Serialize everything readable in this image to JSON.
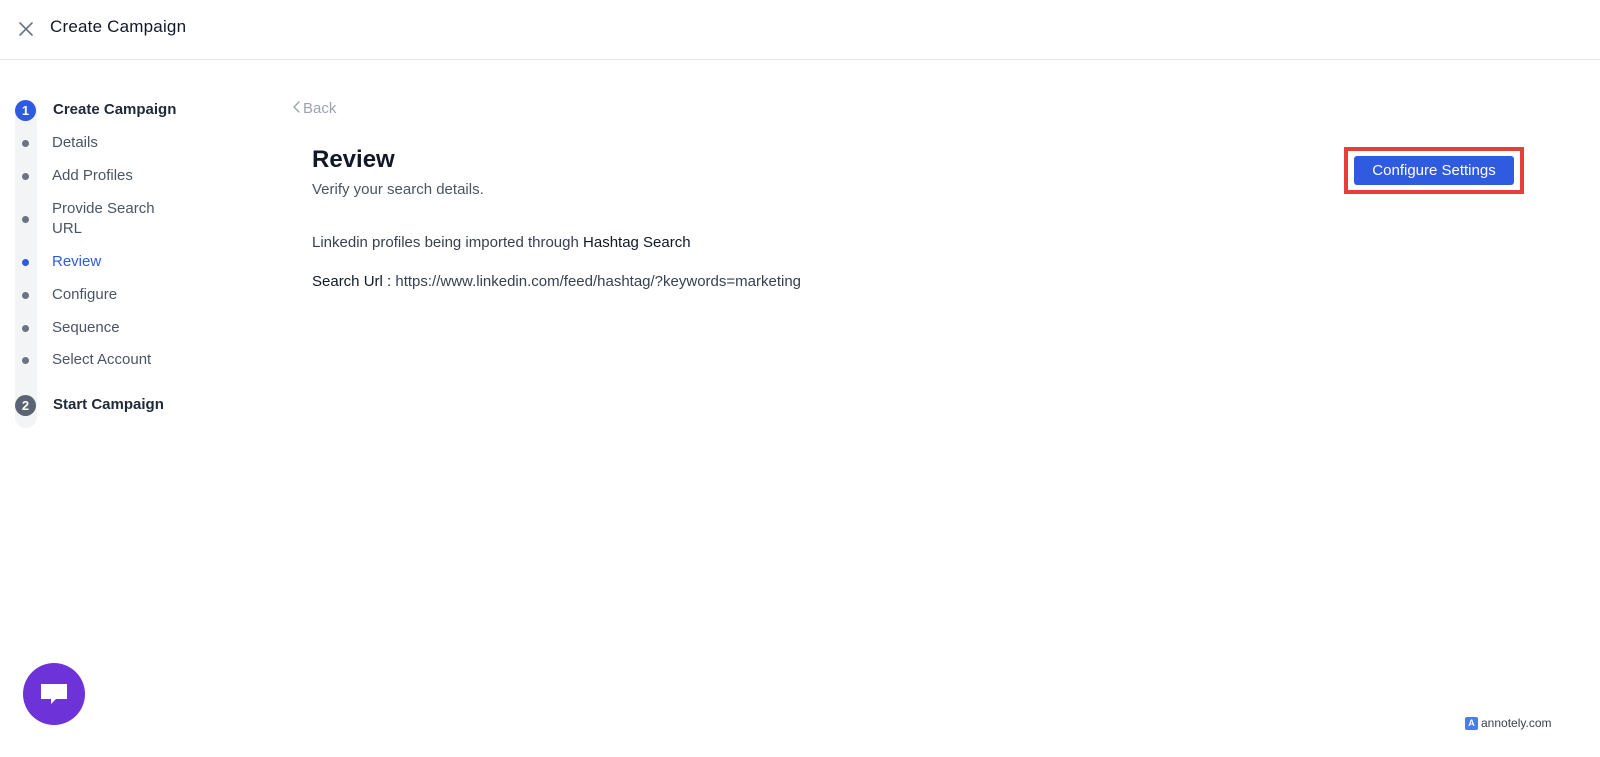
{
  "header": {
    "title": "Create Campaign"
  },
  "stepper": {
    "steps": [
      {
        "number": "1",
        "title": "Create Campaign"
      },
      {
        "number": "2",
        "title": "Start Campaign"
      }
    ],
    "items": [
      {
        "label": "Details"
      },
      {
        "label": "Add Profiles"
      },
      {
        "label": "Provide Search URL"
      },
      {
        "label": "Review"
      },
      {
        "label": "Configure"
      },
      {
        "label": "Sequence"
      },
      {
        "label": "Select Account"
      }
    ],
    "active_item": "Review"
  },
  "content": {
    "back_label": "Back",
    "title": "Review",
    "subtitle": "Verify your search details.",
    "import_text": "Linkedin profiles being imported through",
    "import_method": "Hashtag Search",
    "search_url_label": "Search Url :",
    "search_url_value": "https://www.linkedin.com/feed/hashtag/?keywords=marketing",
    "configure_button": "Configure Settings"
  },
  "watermark": {
    "badge": "A",
    "text": "annotely.com"
  },
  "colors": {
    "primary": "#2f5be0",
    "highlight": "#e53e3e",
    "chat": "#6d33d9",
    "muted": "#6b7280"
  },
  "icons": {
    "close": "close-icon",
    "back": "chevron-left-icon",
    "chat": "chat-icon"
  }
}
